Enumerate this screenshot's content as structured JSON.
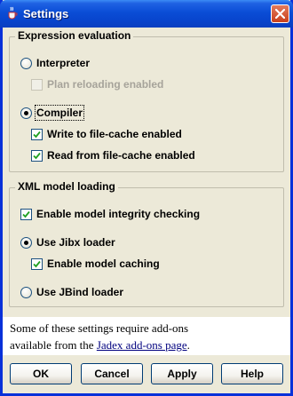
{
  "window": {
    "title": "Settings",
    "app_icon": "java-cup-icon",
    "close_icon": "close-icon"
  },
  "expression_group": {
    "title": "Expression evaluation",
    "interpreter": {
      "label": "Interpreter",
      "selected": false
    },
    "plan_reloading": {
      "label": "Plan reloading enabled",
      "checked": false,
      "enabled": false
    },
    "compiler": {
      "label": "Compiler",
      "selected": true
    },
    "write_cache": {
      "label": "Write to file-cache enabled",
      "checked": true
    },
    "read_cache": {
      "label": "Read from file-cache enabled",
      "checked": true
    }
  },
  "xml_group": {
    "title": "XML model loading",
    "integrity": {
      "label": "Enable model integrity checking",
      "checked": true
    },
    "jibx": {
      "label": "Use Jibx loader",
      "selected": true
    },
    "caching": {
      "label": "Enable model caching",
      "checked": true
    },
    "jbind": {
      "label": "Use JBind loader",
      "selected": false
    }
  },
  "note": {
    "text_line1": "Some of these settings require add-ons",
    "text_line2_prefix": "available from the ",
    "link": "Jadex add-ons page",
    "text_line2_suffix": "."
  },
  "buttons": {
    "ok": "OK",
    "cancel": "Cancel",
    "apply": "Apply",
    "help": "Help"
  },
  "colors": {
    "titlebar": "#0a4dd6",
    "background": "#ece9d8",
    "link": "#00007f"
  }
}
